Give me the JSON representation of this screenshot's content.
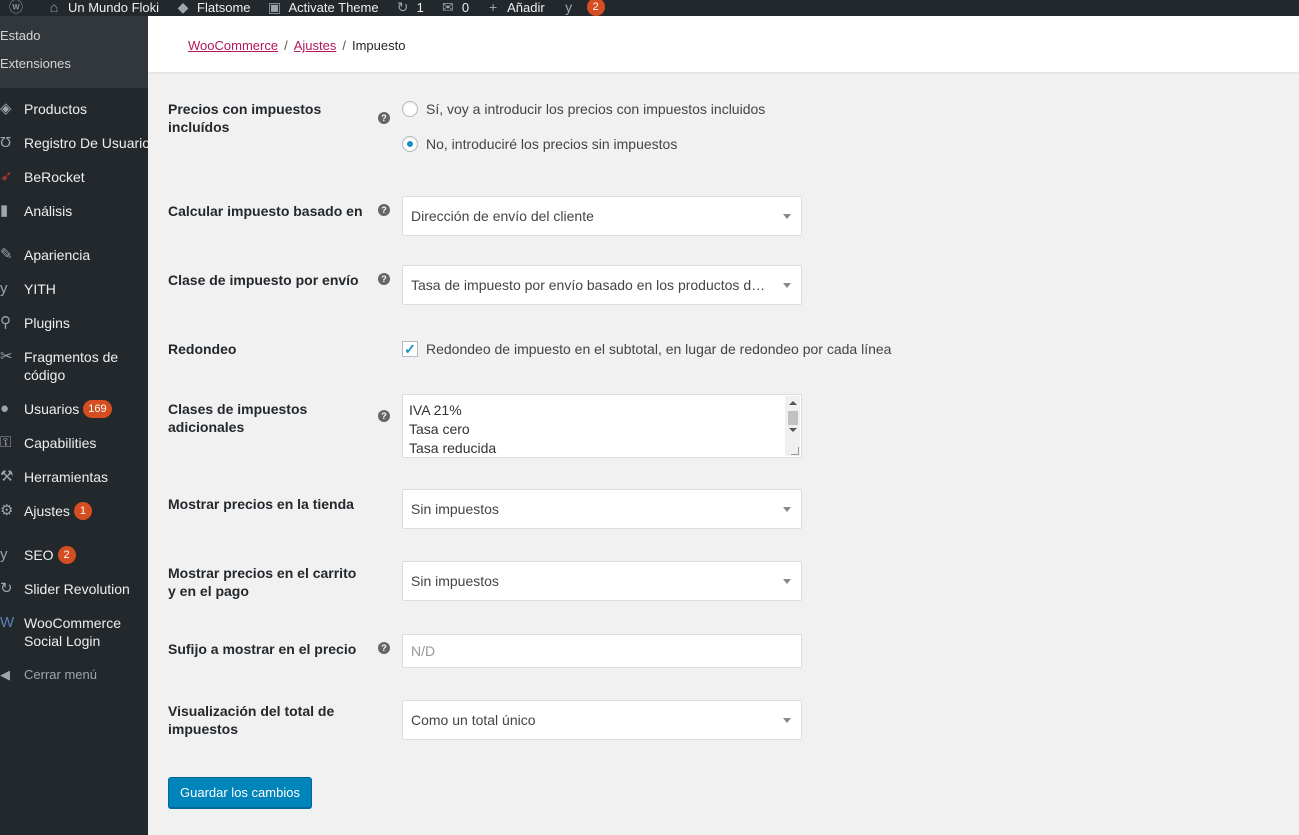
{
  "adminbar": {
    "items": [
      {
        "icon": "wordpress-icon",
        "label": ""
      },
      {
        "icon": "home-icon",
        "label": "Un Mundo Floki"
      },
      {
        "icon": "flatsome-icon",
        "label": "Flatsome"
      },
      {
        "icon": "theme-icon",
        "label": "Activate Theme"
      },
      {
        "icon": "updates-icon",
        "label": "1"
      },
      {
        "icon": "comments-icon",
        "label": "0"
      },
      {
        "icon": "plus-icon",
        "label": "Añadir"
      },
      {
        "icon": "yoast-icon",
        "label": "",
        "badge": "2"
      }
    ]
  },
  "sidebar": {
    "submenu": [
      "Estado",
      "Extensiones"
    ],
    "items": [
      {
        "icon": "products-icon",
        "label": "Productos"
      },
      {
        "icon": "user-registration-icon",
        "label": "Registro De Usuario"
      },
      {
        "icon": "berocket-icon",
        "label": "BeRocket"
      },
      {
        "icon": "analytics-icon",
        "label": "Análisis"
      },
      {
        "icon": "appearance-icon",
        "label": "Apariencia"
      },
      {
        "icon": "yith-icon",
        "label": "YITH"
      },
      {
        "icon": "plugins-icon",
        "label": "Plugins"
      },
      {
        "icon": "code-snippets-icon",
        "label": "Fragmentos de código"
      },
      {
        "icon": "users-icon",
        "label": "Usuarios",
        "badge": "169"
      },
      {
        "icon": "capabilities-icon",
        "label": "Capabilities"
      },
      {
        "icon": "tools-icon",
        "label": "Herramientas"
      },
      {
        "icon": "settings-icon",
        "label": "Ajustes",
        "badge": "1"
      },
      {
        "icon": "seo-icon",
        "label": "SEO",
        "badge": "2"
      },
      {
        "icon": "slider-icon",
        "label": "Slider Revolution"
      },
      {
        "icon": "social-login-icon",
        "label": "WooCommerce Social Login"
      },
      {
        "icon": "collapse-icon",
        "label": "Cerrar menú"
      }
    ]
  },
  "breadcrumb": {
    "items": [
      "WooCommerce",
      "Ajustes",
      "Impuesto"
    ],
    "separator": "/"
  },
  "form": {
    "prices_include_tax": {
      "label": "Precios con impuestos incluídos",
      "options": [
        "Sí, voy a introducir los precios con impuestos incluidos",
        "No, introduciré los precios sin impuestos"
      ],
      "selected": 1
    },
    "tax_based_on": {
      "label": "Calcular impuesto basado en",
      "value": "Dirección de envío del cliente"
    },
    "shipping_tax_class": {
      "label": "Clase de impuesto por envío",
      "value": "Tasa de impuesto por envío basado en los productos del carrito"
    },
    "rounding": {
      "label": "Redondeo",
      "checkbox_label": "Redondeo de impuesto en el subtotal, en lugar de redondeo por cada línea",
      "checked": true
    },
    "tax_classes": {
      "label": "Clases de impuestos adicionales",
      "lines": [
        "IVA 21%",
        "Tasa cero",
        "Tasa reducida"
      ]
    },
    "display_shop": {
      "label": "Mostrar precios en la tienda",
      "value": "Sin impuestos"
    },
    "display_cart": {
      "label": "Mostrar precios en el carrito y en el pago",
      "value": "Sin impuestos"
    },
    "price_suffix": {
      "label": "Sufijo a mostrar en el precio",
      "placeholder": "N/D"
    },
    "tax_total_display": {
      "label": "Visualización del total de impuestos",
      "value": "Como un total único"
    },
    "save_label": "Guardar los cambios"
  },
  "colors": {
    "sidebar_bg": "#23282d",
    "badge": "#d54e21",
    "primary_button": "#0085ba",
    "link": "#b4175f"
  }
}
